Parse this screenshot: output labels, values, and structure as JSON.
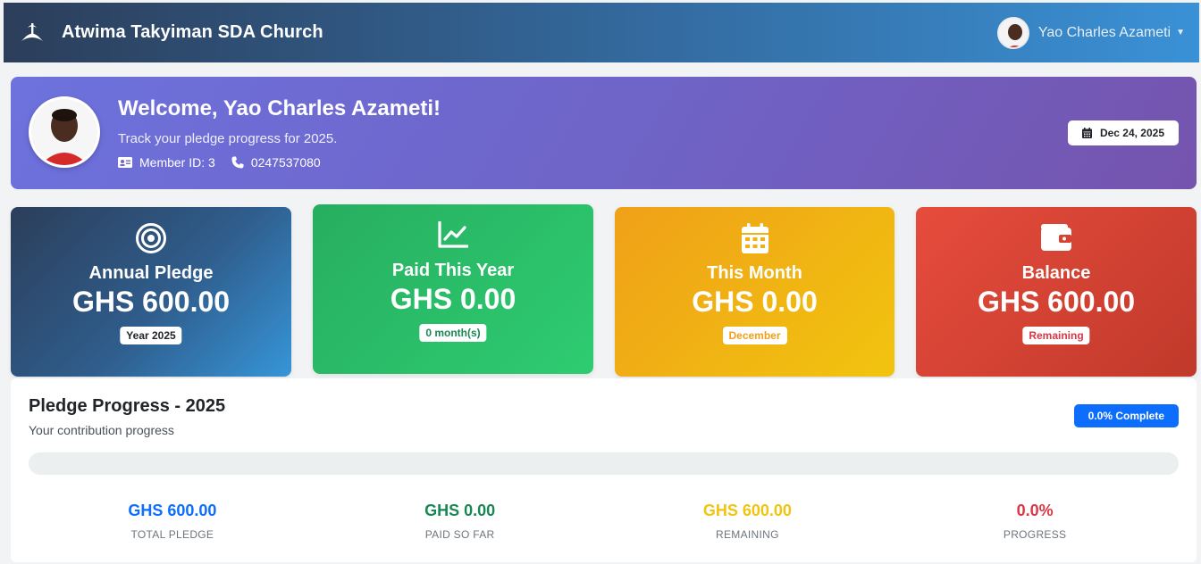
{
  "navbar": {
    "brand_name": "Atwima Takyiman SDA Church",
    "user_name": "Yao Charles Azameti"
  },
  "welcome": {
    "title": "Welcome, Yao Charles Azameti!",
    "subtitle": "Track your pledge progress for 2025.",
    "member_id": "Member ID: 3",
    "phone": "0247537080",
    "date": "Dec 24, 2025"
  },
  "cards": [
    {
      "icon": "target-icon",
      "title": "Annual Pledge",
      "value": "GHS 600.00",
      "pill": "Year 2025",
      "pill_color": "#212529"
    },
    {
      "icon": "chart-line-icon",
      "title": "Paid This Year",
      "value": "GHS 0.00",
      "pill": "0 month(s)",
      "pill_color": "#198754"
    },
    {
      "icon": "calendar-icon",
      "title": "This Month",
      "value": "GHS 0.00",
      "pill": "December",
      "pill_color": "#f0a018"
    },
    {
      "icon": "wallet-icon",
      "title": "Balance",
      "value": "GHS 600.00",
      "pill": "Remaining",
      "pill_color": "#dc3545"
    }
  ],
  "progress": {
    "title": "Pledge Progress - 2025",
    "subtitle": "Your contribution progress",
    "badge": "0.0% Complete",
    "percent": 0,
    "stats": [
      {
        "value": "GHS 600.00",
        "label": "TOTAL PLEDGE",
        "color": "#0d6efd"
      },
      {
        "value": "GHS 0.00",
        "label": "PAID SO FAR",
        "color": "#198754"
      },
      {
        "value": "GHS 600.00",
        "label": "REMAINING",
        "color": "#f1c40f"
      },
      {
        "value": "0.0%",
        "label": "PROGRESS",
        "color": "#dc3545"
      }
    ]
  }
}
